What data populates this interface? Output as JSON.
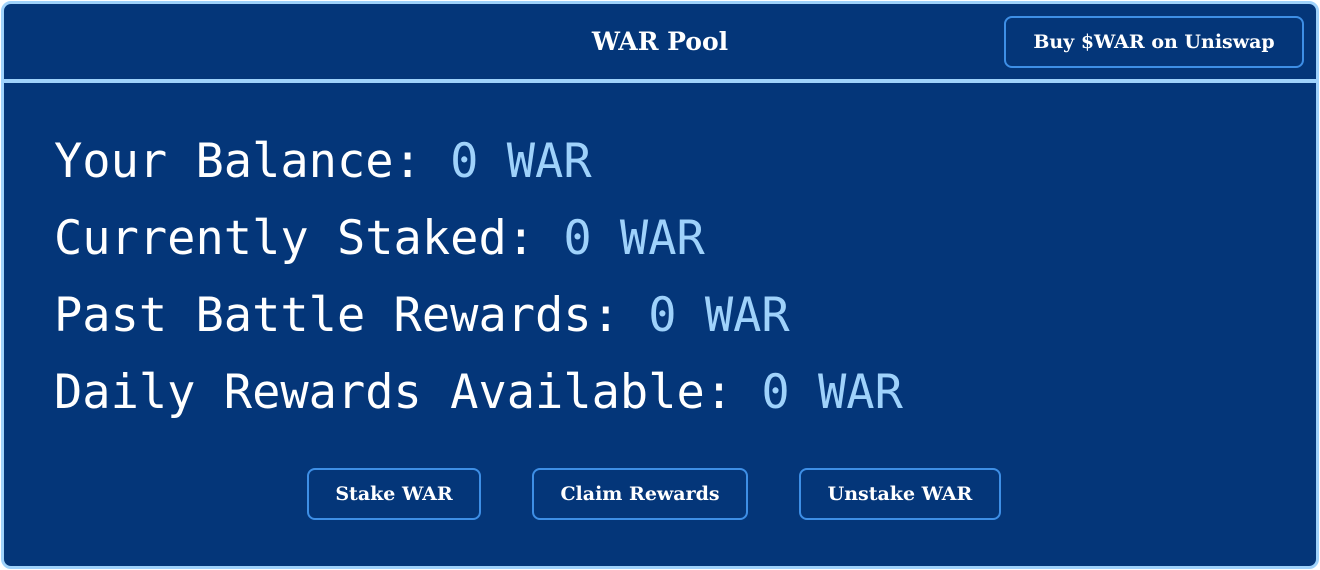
{
  "header": {
    "title": "WAR Pool",
    "buy_label": "Buy $WAR on Uniswap"
  },
  "stats": [
    {
      "label": "Your Balance:",
      "value": "0 WAR"
    },
    {
      "label": "Currently Staked:",
      "value": "0 WAR"
    },
    {
      "label": "Past Battle Rewards:",
      "value": "0 WAR"
    },
    {
      "label": "Daily Rewards Available:",
      "value": "0 WAR"
    }
  ],
  "actions": {
    "stake_label": "Stake WAR",
    "claim_label": "Claim Rewards",
    "unstake_label": "Unstake WAR"
  },
  "colors": {
    "panel_background": "#043679",
    "border": "#9fd2fb",
    "value_text": "#9fd2fb",
    "button_border": "#3e8fe6",
    "text": "#ffffff"
  }
}
